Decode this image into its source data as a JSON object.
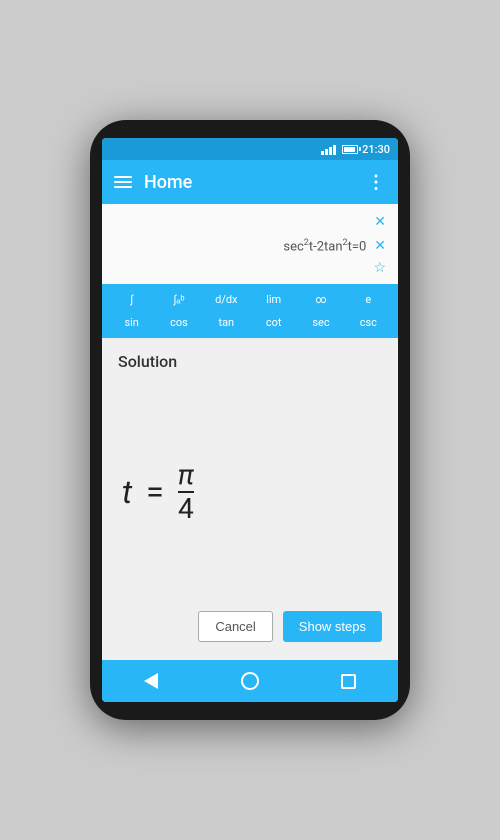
{
  "status_bar": {
    "time": "21:30"
  },
  "app_bar": {
    "title": "Home",
    "menu_icon": "menu-icon",
    "more_icon": "⋮"
  },
  "expressions": [
    {
      "id": "empty",
      "text": "",
      "has_x": true,
      "has_star": false
    },
    {
      "id": "expr1",
      "text": "sec²t-2tan²t=0",
      "has_x": true,
      "has_star": false
    },
    {
      "id": "expr2",
      "text": "",
      "has_x": false,
      "has_star": true
    }
  ],
  "keyboard": {
    "row1": [
      "∫",
      "∫ₐᵇ",
      "d/dx",
      "lim",
      "∞",
      "e"
    ],
    "row2": [
      "sin",
      "cos",
      "tan",
      "cot",
      "sec",
      "csc"
    ]
  },
  "solution": {
    "label": "Solution",
    "variable": "t",
    "equals": "=",
    "numerator": "π",
    "denominator": "4"
  },
  "buttons": {
    "cancel": "Cancel",
    "show_steps": "Show steps"
  },
  "nav": {
    "back": "back",
    "home": "home",
    "recents": "recents"
  }
}
